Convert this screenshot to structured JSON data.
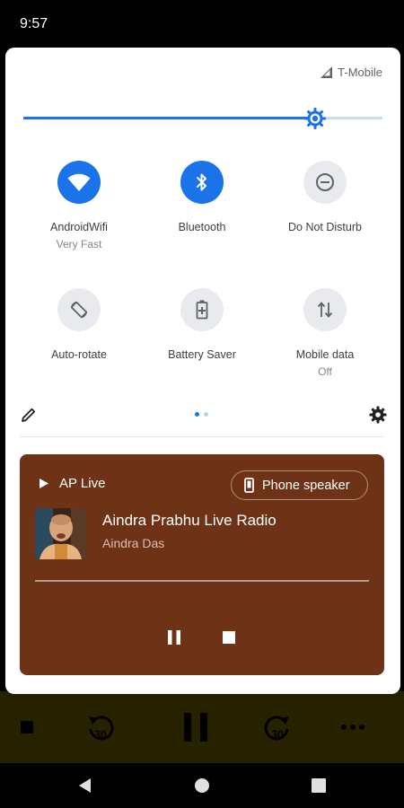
{
  "status_bar": {
    "time": "9:57"
  },
  "quick_settings": {
    "carrier": "T-Mobile",
    "brightness_level": 0.81,
    "tiles": [
      {
        "label": "AndroidWifi",
        "subtitle": "Very Fast",
        "icon": "wifi-icon",
        "active": true
      },
      {
        "label": "Bluetooth",
        "subtitle": "",
        "icon": "bluetooth-icon",
        "active": true
      },
      {
        "label": "Do Not Disturb",
        "subtitle": "",
        "icon": "do-not-disturb-icon",
        "active": false
      },
      {
        "label": "Auto-rotate",
        "subtitle": "",
        "icon": "auto-rotate-icon",
        "active": false
      },
      {
        "label": "Battery Saver",
        "subtitle": "",
        "icon": "battery-saver-icon",
        "active": false
      },
      {
        "label": "Mobile data",
        "subtitle": "Off",
        "icon": "mobile-data-icon",
        "active": false
      }
    ],
    "page_count": 2,
    "current_page": 1
  },
  "media": {
    "app_name": "AP Live",
    "output_device": "Phone speaker",
    "title": "Aindra Prabhu Live Radio",
    "artist": "Aindra Das",
    "background_color": "#6e3316"
  },
  "colors": {
    "accent": "#1a73e8",
    "tile_off": "#e8eaed",
    "background_app": "#262200"
  },
  "background_app": {
    "controls": [
      "stop-icon",
      "rewind-30-icon",
      "pause-icon",
      "forward-30-icon",
      "more-icon"
    ],
    "rewind_label": "30",
    "forward_label": "30"
  }
}
